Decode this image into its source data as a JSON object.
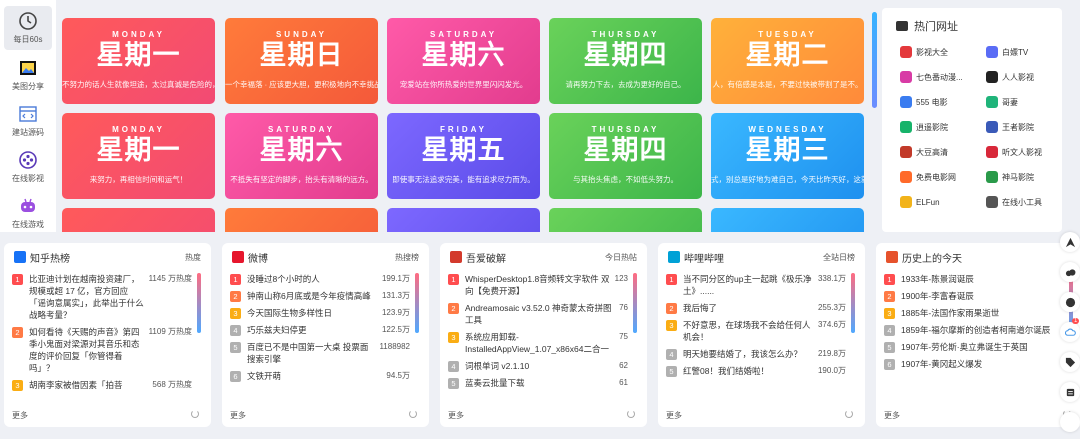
{
  "nav": [
    {
      "label": "每日60s",
      "icon": "clock-icon"
    },
    {
      "label": "美图分享",
      "icon": "image-icon"
    },
    {
      "label": "建站源码",
      "icon": "code-window-icon"
    },
    {
      "label": "在线影视",
      "icon": "film-icon"
    },
    {
      "label": "在线游戏",
      "icon": "gamepad-icon"
    }
  ],
  "cards": [
    {
      "day": "MONDAY",
      "big": "星期一",
      "sub": "不努力的话人生就像坦途，太过真诚是危险的，太过真诚是致命的。",
      "from": "#ff5a5a",
      "to": "#f24a74"
    },
    {
      "day": "SUNDAY",
      "big": "星期日",
      "sub": "一个幸福落 · 应该更大胆，更积极地向不幸挑战。",
      "from": "#ff7b3a",
      "to": "#f4593a"
    },
    {
      "day": "SATURDAY",
      "big": "星期六",
      "sub": "宠爱站在你所热爱的世界里闪闪发光。",
      "from": "#ff5aa8",
      "to": "#e23c8e"
    },
    {
      "day": "THURSDAY",
      "big": "星期四",
      "sub": "请再努力下去，去成为更好的自己。",
      "from": "#6ad25a",
      "to": "#3cb54a"
    },
    {
      "day": "TUESDAY",
      "big": "星期二",
      "sub": "人，有倍感是本是，不要过快被带割了是不。",
      "from": "#ffb13a",
      "to": "#ff8a3a"
    },
    {
      "day": "MONDAY",
      "big": "星期一",
      "sub": "来努力，再相信时间和运气！",
      "from": "#ff5a5a",
      "to": "#f24a74"
    },
    {
      "day": "SATURDAY",
      "big": "星期六",
      "sub": "不抵失有坚定的脚步，抬头有清晰的远方。",
      "from": "#ff5aa8",
      "to": "#e23c8e"
    },
    {
      "day": "FRIDAY",
      "big": "星期五",
      "sub": "即使事无法追求完美，能有追求尽力而为。",
      "from": "#7d68ff",
      "to": "#5a4be8"
    },
    {
      "day": "THURSDAY",
      "big": "星期四",
      "sub": "与其抬头焦虑，不如低头努力。",
      "from": "#6ad25a",
      "to": "#3cb54a"
    },
    {
      "day": "WEDNESDAY",
      "big": "星期三",
      "sub": "式，别总是好地为难自己，今天比昨天好，这就是希",
      "from": "#3ab8ff",
      "to": "#1e90ef"
    },
    {
      "day": "",
      "big": "",
      "sub": "",
      "from": "#ff5a5a",
      "to": "#f24a74"
    },
    {
      "day": "",
      "big": "",
      "sub": "",
      "from": "#ff7b3a",
      "to": "#f4593a"
    },
    {
      "day": "",
      "big": "",
      "sub": "",
      "from": "#7d68ff",
      "to": "#5a4be8"
    },
    {
      "day": "",
      "big": "",
      "sub": "",
      "from": "#6ad25a",
      "to": "#3cb54a"
    },
    {
      "day": "",
      "big": "",
      "sub": "",
      "from": "#3ab8ff",
      "to": "#1e90ef"
    }
  ],
  "hot": {
    "title": "热门网址",
    "sites": [
      {
        "name": "影视大全",
        "color": "#e4393c"
      },
      {
        "name": "白嫖TV",
        "color": "#5a6cf5"
      },
      {
        "name": "七色番动漫...",
        "color": "#d83ba5"
      },
      {
        "name": "人人影视",
        "color": "#222222"
      },
      {
        "name": "555 电影",
        "color": "#3a7cf0"
      },
      {
        "name": "哥妻",
        "color": "#1fb47a"
      },
      {
        "name": "逍遥影院",
        "color": "#17b36a"
      },
      {
        "name": "王者影院",
        "color": "#3a5ab8"
      },
      {
        "name": "大豆高清",
        "color": "#c23a2a"
      },
      {
        "name": "听文人影视",
        "color": "#d8283a"
      },
      {
        "name": "免费电影网",
        "color": "#ff6a2a"
      },
      {
        "name": "神马影院",
        "color": "#2a9a4a"
      },
      {
        "name": "ELFun",
        "color": "#f2b31a"
      },
      {
        "name": "在线小工具",
        "color": "#555555"
      }
    ]
  },
  "panels": [
    {
      "title": "知乎热榜",
      "tag": "热度",
      "icon": "zhihu-icon",
      "iconColor": "#1772f6",
      "items": [
        {
          "n": "1",
          "text": "比亚迪计划在越南投资建厂，规模或超 17 亿，官方回应「谣询意属实」，此举出于什么战略考量？",
          "val": "1145 万热度"
        },
        {
          "n": "2",
          "text": "如何看待《天赐的声音》第四季小鬼面对梁源对其音乐和态度的评价回复「你管得着吗」？",
          "val": "1109 万热度"
        },
        {
          "n": "3",
          "text": "胡南李家被借因素「拍菩",
          "val": "568 万热度"
        }
      ],
      "more": "更多"
    },
    {
      "title": "微博",
      "tag": "热搜榜",
      "icon": "weibo-icon",
      "iconColor": "#e6162d",
      "items": [
        {
          "n": "1",
          "text": "没睡过8个小时的人",
          "val": "199.1万"
        },
        {
          "n": "2",
          "text": "钟南山称6月底或是今年疫情高峰",
          "val": "131.3万"
        },
        {
          "n": "3",
          "text": "今天国际生物多样性日",
          "val": "123.9万"
        },
        {
          "n": "4",
          "text": "巧乐兹夫妇停更",
          "val": "122.5万"
        },
        {
          "n": "5",
          "text": "百度已不是中国第一大桌 投票面搜索引擎",
          "val": "1188982"
        },
        {
          "n": "6",
          "text": "文铁开萌",
          "val": "94.5万"
        }
      ],
      "more": "更多"
    },
    {
      "title": "吾爱破解",
      "tag": "今日热帖",
      "icon": "52pojie-icon",
      "iconColor": "#d33a2c",
      "items": [
        {
          "n": "1",
          "text": "WhisperDesktop1.8音频转文字软件 双向【免费开源】",
          "val": "123"
        },
        {
          "n": "2",
          "text": "Andreamosaic v3.52.0 神奇蒙太奇拼图工具",
          "val": "76"
        },
        {
          "n": "3",
          "text": "系统应用卸载-InstalledAppView_1.07_x86x64二合一",
          "val": "75"
        },
        {
          "n": "4",
          "text": "词根单词 v2.1.10",
          "val": "62"
        },
        {
          "n": "5",
          "text": "蓝奏云批量下载",
          "val": "61"
        }
      ],
      "more": "更多"
    },
    {
      "title": "哔哩哔哩",
      "tag": "全站日榜",
      "icon": "bilibili-icon",
      "iconColor": "#00a1d6",
      "items": [
        {
          "n": "1",
          "text": "当不同分区的up主一起跳《极乐净土》......",
          "val": "338.1万"
        },
        {
          "n": "2",
          "text": "我后悔了",
          "val": "255.3万"
        },
        {
          "n": "3",
          "text": "不好意思，在球场我不会给任何人机会！",
          "val": "374.6万"
        },
        {
          "n": "4",
          "text": "明天她要结婚了，我该怎么办？",
          "val": "219.8万"
        },
        {
          "n": "5",
          "text": "红警08！我们结婚啦！",
          "val": "190.0万"
        }
      ],
      "more": "更多"
    },
    {
      "title": "历史上的今天",
      "tag": "",
      "icon": "history-icon",
      "iconColor": "#e6522c",
      "items": [
        {
          "n": "1",
          "text": "1933年-陈景润诞辰",
          "val": ""
        },
        {
          "n": "2",
          "text": "1900年-李富春诞辰",
          "val": ""
        },
        {
          "n": "3",
          "text": "1885年-法国作家雨果逝世",
          "val": ""
        },
        {
          "n": "4",
          "text": "1859年-福尔摩斯的创造者柯南道尔诞辰",
          "val": ""
        },
        {
          "n": "5",
          "text": "1907年-劳伦斯·奥立弗诞生于英国",
          "val": ""
        },
        {
          "n": "6",
          "text": "1907年-黄冈起义爆发",
          "val": ""
        }
      ],
      "more": "更多"
    }
  ],
  "numColors": [
    "#ff4d4f",
    "#ff7a45",
    "#faad14",
    "#b0b0b0",
    "#b0b0b0",
    "#b0b0b0"
  ],
  "badge": "1"
}
